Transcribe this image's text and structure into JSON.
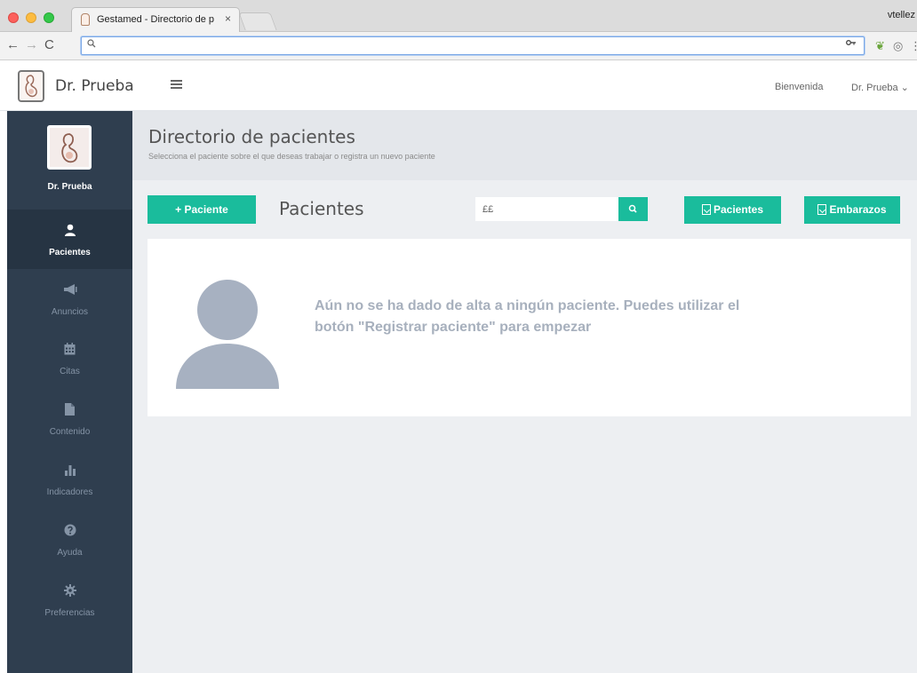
{
  "browser": {
    "tab_title": "Gestamed - Directorio de paci",
    "tab_close": "×",
    "profile_name": "vtellez",
    "url": "",
    "nav": {
      "back": "←",
      "forward": "→",
      "reload": "C"
    },
    "extensions": {
      "evernote": "❦",
      "camera": "◎",
      "menu": "⋮"
    }
  },
  "header": {
    "name": "Dr. Prueba",
    "welcome": "Bienvenida",
    "user_menu": "Dr. Prueba ⌄"
  },
  "sidebar": {
    "user": "Dr. Prueba",
    "items": [
      {
        "label": "Pacientes",
        "icon": "user-icon",
        "active": true
      },
      {
        "label": "Anuncios",
        "icon": "megaphone-icon",
        "active": false
      },
      {
        "label": "Citas",
        "icon": "calendar-icon",
        "active": false
      },
      {
        "label": "Contenido",
        "icon": "document-icon",
        "active": false
      },
      {
        "label": "Indicadores",
        "icon": "bar-chart-icon",
        "active": false
      },
      {
        "label": "Ayuda",
        "icon": "help-icon",
        "active": false
      },
      {
        "label": "Preferencias",
        "icon": "gear-icon",
        "active": false
      }
    ]
  },
  "page": {
    "title": "Directorio de pacientes",
    "subtitle": "Selecciona el paciente sobre el que deseas trabajar o registra un nuevo paciente",
    "add_button": "+ Paciente",
    "list_title": "Pacientes",
    "search_value": "££",
    "export_pacientes": "Pacientes",
    "export_embarazos": "Embarazos",
    "empty_message": "Aún no se ha dado de alta a ningún paciente. Puedes utilizar el botón \"Registrar paciente\" para empezar"
  },
  "colors": {
    "accent": "#1abc9c",
    "sidebar_bg": "#2f3e4f",
    "sidebar_active": "#263443",
    "empty_text": "#a7b0bd"
  }
}
